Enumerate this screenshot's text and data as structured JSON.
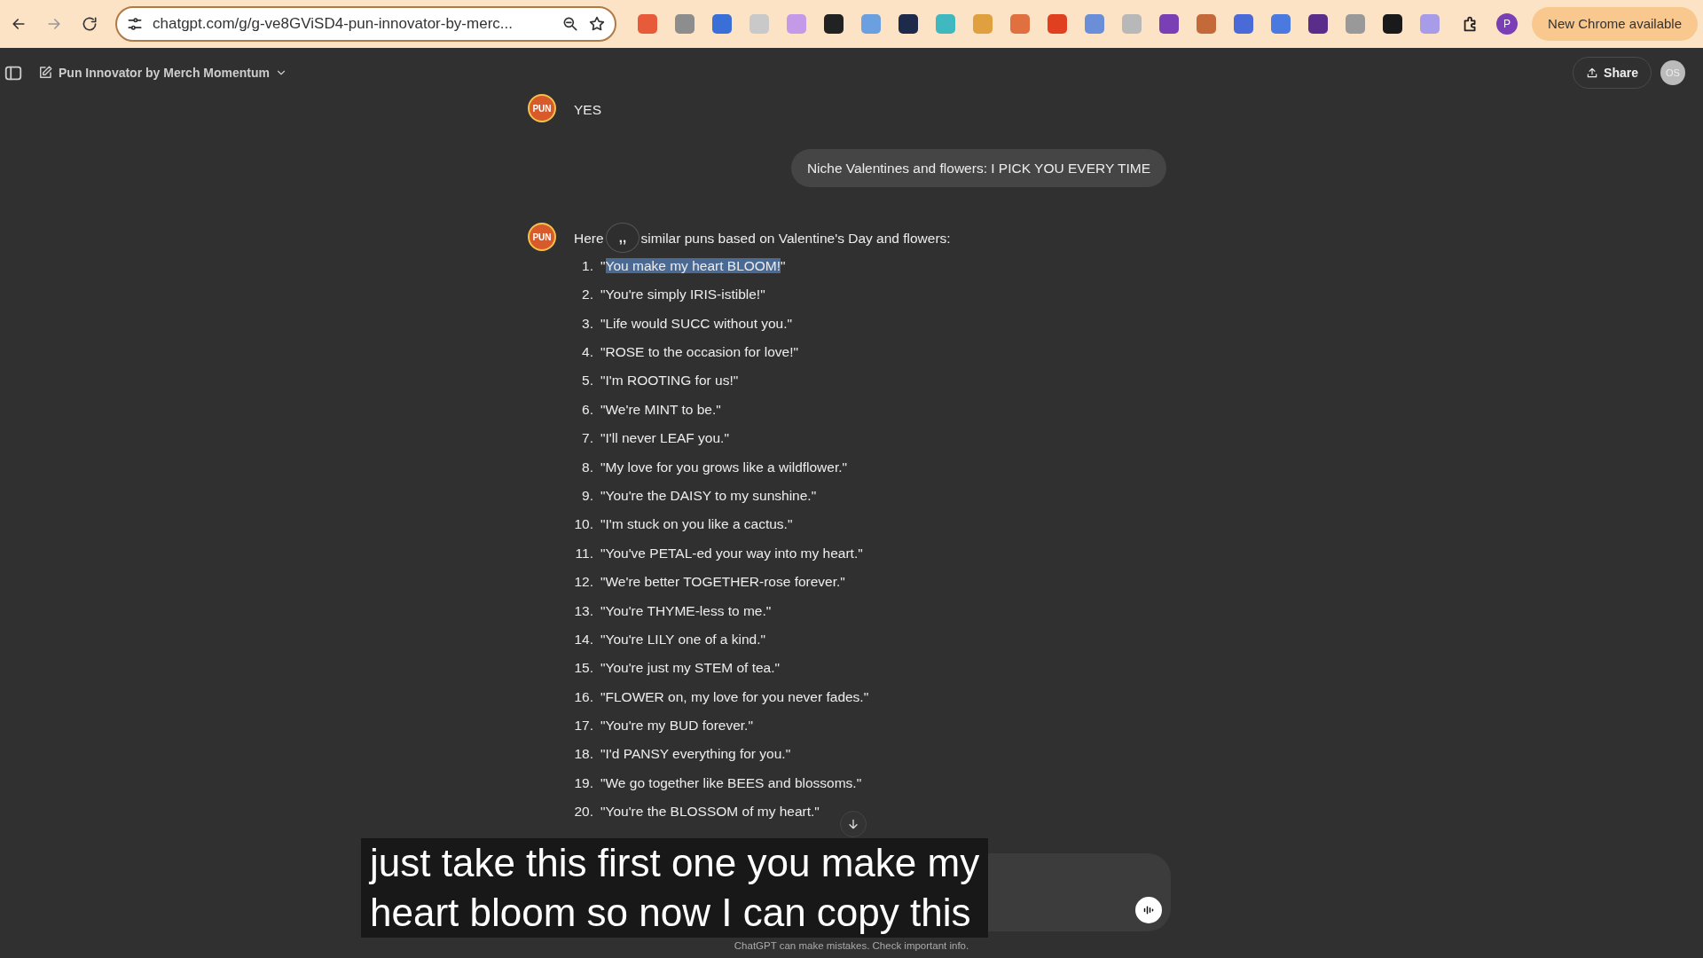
{
  "browser": {
    "url": "chatgpt.com/g/g-ve8GViSD4-pun-innovator-by-merc...",
    "profile_initial": "P",
    "update_button": "New Chrome available"
  },
  "header": {
    "title": "Pun Innovator by Merch Momentum",
    "share": "Share",
    "avatar_initials": "OS"
  },
  "messages": [
    {
      "kind": "bot",
      "avatar": "PUN",
      "text": "YES"
    },
    {
      "kind": "user",
      "text": "Niche Valentines and flowers: I PICK YOU EVERY TIME"
    },
    {
      "kind": "bot",
      "avatar": "PUN",
      "intro_start": "Here",
      "intro_end": "similar puns based on Valentine's Day and flowers:",
      "quote_button": ",,",
      "items": [
        {
          "number": "1.",
          "segments": [
            {
              "text": "\"",
              "selected": false
            },
            {
              "text": "You make my heart BLOOM!",
              "selected": true
            },
            {
              "text": "\"",
              "selected": false
            }
          ]
        },
        {
          "number": "2.",
          "segments": [
            {
              "text": "\"You're simply IRIS-istible!\"",
              "selected": false
            }
          ]
        },
        {
          "number": "3.",
          "segments": [
            {
              "text": "\"Life would SUCC without you.\"",
              "selected": false
            }
          ]
        },
        {
          "number": "4.",
          "segments": [
            {
              "text": "\"ROSE to the occasion for love!\"",
              "selected": false
            }
          ]
        },
        {
          "number": "5.",
          "segments": [
            {
              "text": "\"I'm ROOTING for us!\"",
              "selected": false
            }
          ]
        },
        {
          "number": "6.",
          "segments": [
            {
              "text": "\"We're MINT to be.\"",
              "selected": false
            }
          ]
        },
        {
          "number": "7.",
          "segments": [
            {
              "text": "\"I'll never LEAF you.\"",
              "selected": false
            }
          ]
        },
        {
          "number": "8.",
          "segments": [
            {
              "text": "\"My love for you grows like a wildflower.\"",
              "selected": false
            }
          ]
        },
        {
          "number": "9.",
          "segments": [
            {
              "text": "\"You're the DAISY to my sunshine.\"",
              "selected": false
            }
          ]
        },
        {
          "number": "10.",
          "segments": [
            {
              "text": "\"I'm stuck on you like a cactus.\"",
              "selected": false
            }
          ]
        },
        {
          "number": "11.",
          "segments": [
            {
              "text": "\"You've PETAL-ed your way into my heart.\"",
              "selected": false
            }
          ]
        },
        {
          "number": "12.",
          "segments": [
            {
              "text": "\"We're better TOGETHER-rose forever.\"",
              "selected": false
            }
          ]
        },
        {
          "number": "13.",
          "segments": [
            {
              "text": "\"You're THYME-less to me.\"",
              "selected": false
            }
          ]
        },
        {
          "number": "14.",
          "segments": [
            {
              "text": "\"You're LILY one of a kind.\"",
              "selected": false
            }
          ]
        },
        {
          "number": "15.",
          "segments": [
            {
              "text": "\"You're just my STEM of tea.\"",
              "selected": false
            }
          ]
        },
        {
          "number": "16.",
          "segments": [
            {
              "text": "\"FLOWER on, my love for you never fades.\"",
              "selected": false
            }
          ]
        },
        {
          "number": "17.",
          "segments": [
            {
              "text": "\"You're my BUD forever.\"",
              "selected": false
            }
          ]
        },
        {
          "number": "18.",
          "segments": [
            {
              "text": "\"I'd PANSY everything for you.\"",
              "selected": false
            }
          ]
        },
        {
          "number": "19.",
          "segments": [
            {
              "text": "\"We go together like BEES and blossoms.\"",
              "selected": false
            }
          ]
        },
        {
          "number": "20.",
          "segments": [
            {
              "text": "\"You're the BLOSSOM of my heart.\"",
              "selected": false
            }
          ]
        }
      ]
    }
  ],
  "footer_note": "ChatGPT can make mistakes. Check important info.",
  "caption": [
    "just take this first one you make my",
    "heart bloom so now I can copy this"
  ]
}
